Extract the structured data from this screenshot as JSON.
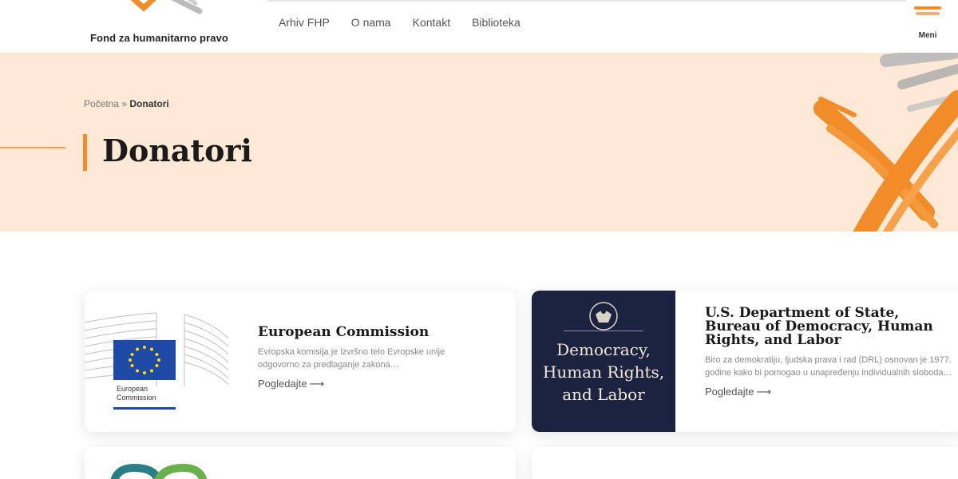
{
  "header": {
    "logo_text": "Fond za humanitarno pravo",
    "nav": [
      "Arhiv FHP",
      "O nama",
      "Kontakt",
      "Biblioteka"
    ],
    "menu_label": "Meni"
  },
  "hero": {
    "breadcrumb_home": "Početna",
    "breadcrumb_sep": " » ",
    "breadcrumb_current": "Donatori",
    "title": "Donatori"
  },
  "cards": [
    {
      "title": "European Commission",
      "description": "Evropska komisija je izvršno telo Evropske unije odgovorno za predlaganje zakona…",
      "link": "Pogledajte",
      "logo_caption_1": "European",
      "logo_caption_2": "Commission"
    },
    {
      "title": "U.S. Department of State, Bureau of Democracy, Human Rights, and Labor",
      "description": "Biro za demokratiju, ljudska prava i rad (DRL) osnovan je 1977. godine kako bi pomogao u unapređenju individualnih sloboda…",
      "link": "Pogledajte",
      "logo_text_1": "Democracy,",
      "logo_text_2": "Human Rights,",
      "logo_text_3": "and Labor"
    }
  ],
  "colors": {
    "accent": "#f28c28",
    "hero_bg": "#fde9d6",
    "dos_navy": "#1b2340",
    "eu_blue": "#1f49a6",
    "eu_yellow": "#ffdd00"
  }
}
